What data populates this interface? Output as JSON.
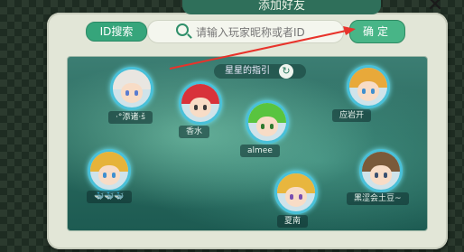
{
  "header": {
    "title": "添加好友"
  },
  "search": {
    "id_button_label": "ID搜索",
    "placeholder": "请输入玩家昵称或者ID",
    "confirm_label": "确定"
  },
  "map": {
    "title": "星星的指引",
    "friends": [
      {
        "name": "·°添诸·š",
        "hair": "#e9e6e1",
        "eye": "#5a7cd0"
      },
      {
        "name": "香水",
        "hair": "#d8323a",
        "eye": "#3a3a3a"
      },
      {
        "name": "almee",
        "hair": "#59c43f",
        "eye": "#2f7a30"
      },
      {
        "name": "应岩开",
        "hair": "#e8a93a",
        "eye": "#3f8fd0"
      },
      {
        "name": "🐳🐳🐳",
        "hair": "#e6b33a",
        "eye": "#3f8fd0"
      },
      {
        "name": "夏南",
        "hair": "#e8b63e",
        "eye": "#7a4fb0"
      },
      {
        "name": "黑涩会土豆~",
        "hair": "#7a5a3a",
        "eye": "#3a5070"
      }
    ]
  },
  "colors": {
    "accent": "#36a57b",
    "arrow": "#e8332b",
    "glow": "#49c0d8"
  }
}
